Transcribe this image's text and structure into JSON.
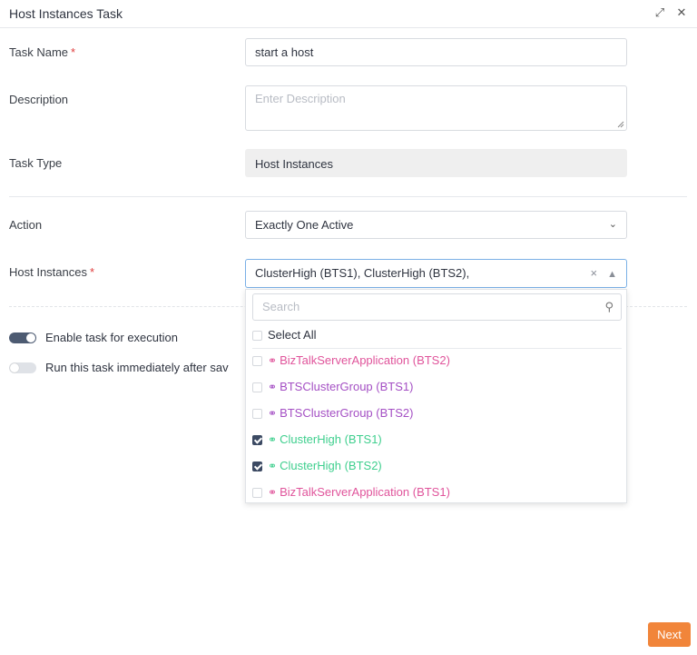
{
  "header": {
    "title": "Host Instances Task",
    "expand_icon": "expand-icon",
    "close_icon": "close-icon"
  },
  "form": {
    "task_name": {
      "label": "Task Name",
      "required": "*",
      "value": "start a host"
    },
    "description": {
      "label": "Description",
      "placeholder": "Enter Description"
    },
    "task_type": {
      "label": "Task Type",
      "value": "Host Instances"
    },
    "action": {
      "label": "Action",
      "value": "Exactly One Active"
    },
    "host_instances": {
      "label": "Host Instances",
      "required": "*",
      "value": "ClusterHigh (BTS1), ClusterHigh (BTS2),"
    }
  },
  "toggles": {
    "enable": {
      "label": "Enable task for execution",
      "on": true
    },
    "run_immediately": {
      "label": "Run this task immediately after sav",
      "on": false
    }
  },
  "dropdown": {
    "search_placeholder": "Search",
    "select_all": "Select All",
    "options": [
      {
        "label": "BizTalkServerApplication (BTS2)",
        "checked": false,
        "color": "#e0549b"
      },
      {
        "label": "BTSClusterGroup (BTS1)",
        "checked": false,
        "color": "#a44fc4"
      },
      {
        "label": "BTSClusterGroup (BTS2)",
        "checked": false,
        "color": "#a44fc4"
      },
      {
        "label": "ClusterHigh (BTS1)",
        "checked": true,
        "color": "#3fcf8e"
      },
      {
        "label": "ClusterHigh (BTS2)",
        "checked": true,
        "color": "#3fcf8e"
      },
      {
        "label": "BizTalkServerApplication (BTS1)",
        "checked": false,
        "color": "#e0549b"
      }
    ]
  },
  "footer": {
    "next_label": "Next"
  }
}
